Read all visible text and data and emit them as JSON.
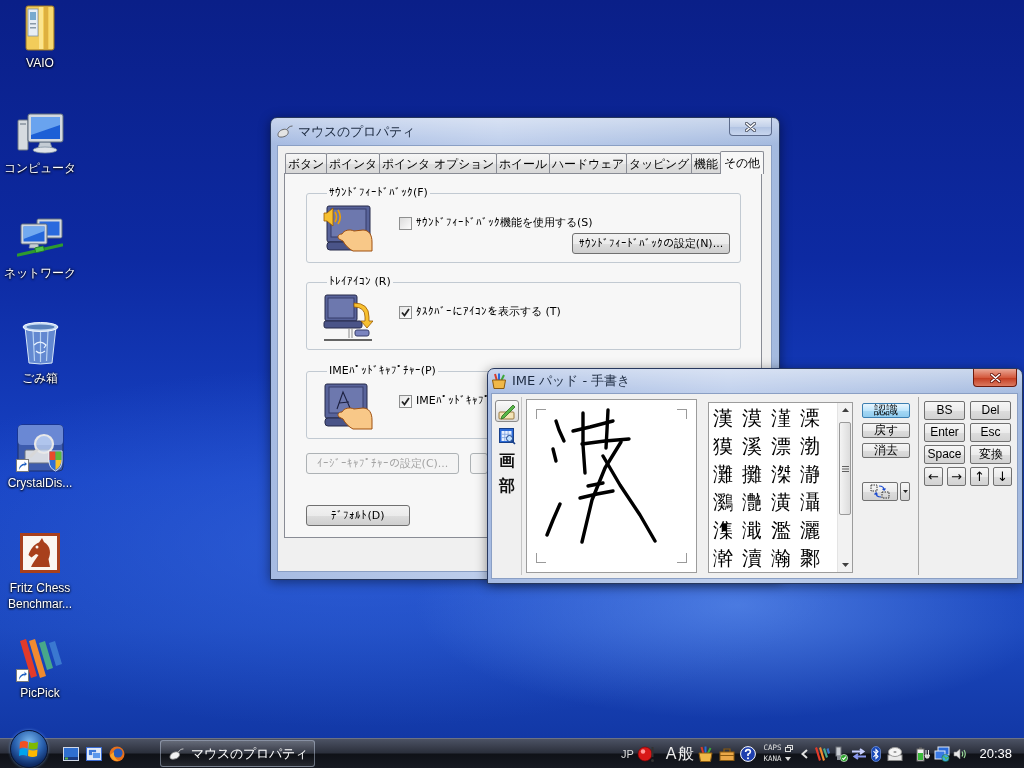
{
  "desktop": {
    "icons": [
      {
        "label": "VAIO",
        "kind": "folder",
        "shortcut": false
      },
      {
        "label": "コンピュータ",
        "kind": "computer",
        "shortcut": false
      },
      {
        "label": "ネットワーク",
        "kind": "network",
        "shortcut": false
      },
      {
        "label": "ごみ箱",
        "kind": "recycle-bin",
        "shortcut": false
      },
      {
        "label": "CrystalDis...",
        "kind": "disk-tool",
        "shortcut": true
      },
      {
        "label": "Fritz Chess Benchmar...",
        "kind": "chess",
        "shortcut": false
      },
      {
        "label": "PicPick",
        "kind": "stripes",
        "shortcut": true
      }
    ]
  },
  "mouse_properties": {
    "title": "マウスのプロパティ",
    "tabs": [
      {
        "label": "ボタン",
        "selected": false
      },
      {
        "label": "ポインタ",
        "selected": false
      },
      {
        "label": "ポインタ オプション",
        "selected": false
      },
      {
        "label": "ホイール",
        "selected": false
      },
      {
        "label": "ハードウェア",
        "selected": false
      },
      {
        "label": "タッピング",
        "selected": false
      },
      {
        "label": "機能",
        "selected": false
      },
      {
        "label": "その他",
        "selected": true
      }
    ],
    "groups": [
      {
        "title": "ｻｳﾝﾄﾞﾌｨｰﾄﾞﾊﾞｯｸ(F)",
        "kind": "sound",
        "checkbox": {
          "label": "ｻｳﾝﾄﾞﾌｨｰﾄﾞﾊﾞｯｸ機能を使用する(S)",
          "checked": false
        },
        "button": "ｻｳﾝﾄﾞﾌｨｰﾄﾞﾊﾞｯｸの設定(N)..."
      },
      {
        "title": "ﾄﾚｲｱｲｺﾝ (R)",
        "kind": "tray",
        "checkbox": {
          "label": "ﾀｽｸﾊﾞｰにｱｲｺﾝを表示する (T)",
          "checked": true
        }
      },
      {
        "title": "IMEﾊﾟｯﾄﾞｷｬﾌﾟﾁｬｰ(P)",
        "kind": "ime",
        "checkbox": {
          "label": "IMEﾊﾟｯﾄﾞｷｬﾌﾟ",
          "checked": true
        }
      }
    ],
    "buttons": [
      {
        "label": "ｲｰｼﾞｰｷｬﾌﾟﾁｬｰの設定(C)...",
        "disabled": true
      },
      {
        "disabled": true
      }
    ],
    "default_button": "ﾃﾞﾌｫﾙﾄ(D)"
  },
  "ime_pad": {
    "title": "IME パッド - 手書き",
    "tools": [
      {
        "kind": "handwriting",
        "selected": true
      },
      {
        "kind": "dictionary",
        "selected": false
      },
      {
        "kind": "text",
        "label": "画",
        "selected": false
      },
      {
        "kind": "text",
        "label": "部",
        "selected": false
      }
    ],
    "candidates": [
      [
        "漢",
        "漠",
        "漌",
        "溧"
      ],
      [
        "獏",
        "溪",
        "漂",
        "渤"
      ],
      [
        "灘",
        "攤",
        "滐",
        "瀞"
      ],
      [
        "鸂",
        "灔",
        "潢",
        "灄"
      ],
      [
        "潗",
        "濈",
        "濫",
        "灑"
      ],
      [
        "澣",
        "瀆",
        "瀚",
        "鄹"
      ]
    ],
    "actions": [
      {
        "label": "認識",
        "selected": true
      },
      {
        "label": "戻す",
        "selected": false
      },
      {
        "label": "消去",
        "selected": false
      }
    ],
    "keys": [
      "BS",
      "Del",
      "Enter",
      "Esc",
      "Space",
      "変換"
    ],
    "arrow_keys": [
      "←",
      "→",
      "↑",
      "↓"
    ]
  },
  "taskbar": {
    "tasks": [
      "マウスのプロパティ"
    ],
    "tray": {
      "language": "JP",
      "input_mode": [
        "A",
        "般"
      ],
      "caps": "CAPS",
      "kana": "KANA",
      "clock": "20:38"
    }
  }
}
